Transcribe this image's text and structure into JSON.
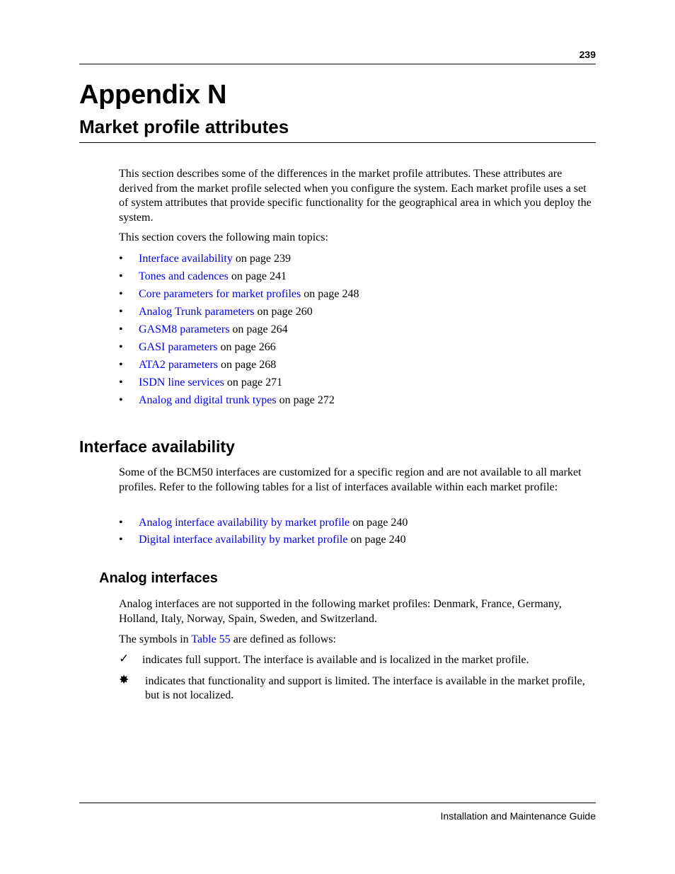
{
  "header": {
    "page_number": "239"
  },
  "titles": {
    "appendix": "Appendix N",
    "chapter": "Market profile attributes"
  },
  "intro": {
    "paragraph": "This section describes some of the differences in the market profile attributes. These attributes are derived from the market profile selected when you configure the system. Each market profile uses a set of system attributes that provide specific functionality for the geographical area in which you deploy the system.",
    "topics_lead": "This section covers the following main topics:",
    "topics": [
      {
        "link": "Interface availability",
        "suffix": " on page 239"
      },
      {
        "link": "Tones and cadences",
        "suffix": " on page 241"
      },
      {
        "link": "Core parameters for market profiles",
        "suffix": " on page 248"
      },
      {
        "link": "Analog Trunk parameters",
        "suffix": " on page 260"
      },
      {
        "link": "GASM8 parameters",
        "suffix": " on page 264"
      },
      {
        "link": "GASI parameters",
        "suffix": " on page 266"
      },
      {
        "link": "ATA2 parameters",
        "suffix": " on page 268"
      },
      {
        "link": "ISDN line services",
        "suffix": " on page 271"
      },
      {
        "link": "Analog and digital trunk types",
        "suffix": " on page 272"
      }
    ]
  },
  "interface_availability": {
    "heading": "Interface availability",
    "paragraph": "Some of the BCM50 interfaces are customized for a specific region and are not available to all market profiles. Refer to the following tables for a list of interfaces available within each market profile:",
    "tables": [
      {
        "link": "Analog interface availability by market profile",
        "suffix": " on page 240"
      },
      {
        "link": "Digital interface availability by market profile",
        "suffix": " on page 240"
      }
    ]
  },
  "analog_interfaces": {
    "heading": "Analog interfaces",
    "paragraph": "Analog interfaces are not supported in the following market profiles: Denmark, France, Germany, Holland, Italy, Norway, Spain, Sweden, and Switzerland.",
    "symbols_prefix": "The symbols in ",
    "symbols_link": "Table 55",
    "symbols_suffix": " are defined as follows:",
    "symbols": [
      {
        "icon": "check-icon",
        "glyph": "✓",
        "text": "indicates full support. The interface is available and is localized in the market profile."
      },
      {
        "icon": "star-icon",
        "glyph": "✸",
        "text": "indicates that functionality and support is limited. The interface is available in the market profile, but is not localized."
      }
    ]
  },
  "bullet_glyph": "•",
  "footer": {
    "text": "Installation and Maintenance Guide"
  },
  "colors": {
    "link": "#0000ee",
    "text": "#000000"
  }
}
